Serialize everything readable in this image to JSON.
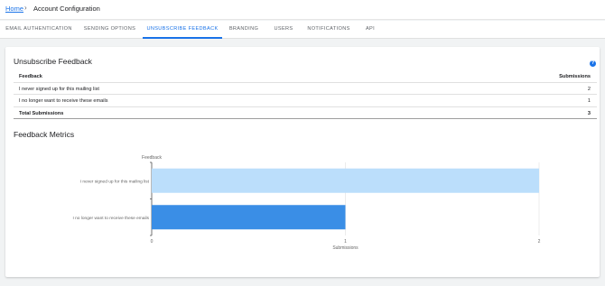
{
  "breadcrumb": {
    "home": "Home",
    "separator": "›",
    "current": "Account Configuration"
  },
  "tabs": [
    {
      "label": "EMAIL AUTHENTICATION",
      "active": false
    },
    {
      "label": "SENDING OPTIONS",
      "active": false
    },
    {
      "label": "UNSUBSCRIBE FEEDBACK",
      "active": true
    },
    {
      "label": "BRANDING",
      "active": false
    },
    {
      "label": "USERS",
      "active": false
    },
    {
      "label": "NOTIFICATIONS",
      "active": false
    },
    {
      "label": "API",
      "active": false
    }
  ],
  "feedback": {
    "title": "Unsubscribe Feedback",
    "help_icon": "help-circle-icon",
    "help_symbol": "?",
    "headers": {
      "feedback": "Feedback",
      "submissions": "Submissions"
    },
    "rows": [
      {
        "feedback": "I never signed up for this mailing list",
        "submissions": "2"
      },
      {
        "feedback": "I no longer want to receive these emails",
        "submissions": "1"
      }
    ],
    "total": {
      "label": "Total Submissions",
      "value": "3"
    }
  },
  "metrics": {
    "title": "Feedback Metrics"
  },
  "chart_data": {
    "type": "bar",
    "orientation": "horizontal",
    "categories": [
      "I never signed up for this mailing list",
      "I no longer want to receive these emails"
    ],
    "values": [
      2,
      1
    ],
    "bar_colors": [
      "#bbdefb",
      "#3a8ee6"
    ],
    "ylabel": "Feedback",
    "xlabel": "Submissions",
    "xlim": [
      0,
      2
    ],
    "x_ticks": [
      "0",
      "1",
      "2"
    ],
    "grid": true
  },
  "colors": {
    "accent": "#1a73e8",
    "card_bg": "#ffffff",
    "page_bg": "#f1f3f4"
  }
}
